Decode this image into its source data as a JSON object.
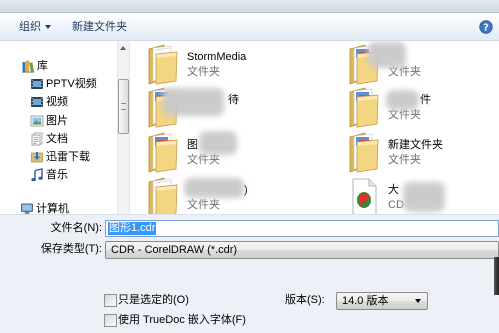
{
  "toolbar": {
    "organize": "组织",
    "organize_icon": "chevron-down-icon",
    "new_folder": "新建文件夹",
    "help_icon": "help-icon"
  },
  "nav": {
    "library": {
      "label": "库",
      "icon": "library-icon"
    },
    "items": [
      {
        "label": "PPTV视频",
        "icon": "video-library-icon"
      },
      {
        "label": "视频",
        "icon": "video-library-icon"
      },
      {
        "label": "图片",
        "icon": "pictures-library-icon"
      },
      {
        "label": "文档",
        "icon": "documents-library-icon"
      },
      {
        "label": "迅雷下载",
        "icon": "download-library-icon"
      },
      {
        "label": "音乐",
        "icon": "music-library-icon"
      }
    ],
    "computer": {
      "label": "计算机",
      "icon": "computer-icon"
    }
  },
  "files": [
    {
      "name": "StormMedia",
      "type": "文件夹",
      "icon": "folder-icon"
    },
    {
      "type": "文件夹",
      "icon": "folder-pictures-icon"
    },
    {
      "name": "待",
      "icon": "folder-pictures-icon"
    },
    {
      "name": "件",
      "type": "文件夹",
      "icon": "folder-pictures-icon"
    },
    {
      "name": "图",
      "type": "文件夹",
      "icon": "folder-pictures-icon"
    },
    {
      "name": "新建文件夹",
      "type": "文件夹",
      "icon": "folder-pictures-icon"
    },
    {
      "name": ")",
      "type": "文件夹",
      "icon": "folder-icon"
    },
    {
      "name": "大",
      "type": "CD",
      "icon": "cdr-file-icon"
    }
  ],
  "form": {
    "filename": {
      "label": "文件名(N):",
      "value": "图形1.cdr"
    },
    "save_type": {
      "label": "保存类型(T):",
      "value": "CDR - CorelDRAW (*.cdr)"
    },
    "only_selected": {
      "label": "只是选定的(O)",
      "checked": false
    },
    "truedoc": {
      "label": "使用 TrueDoc 嵌入字体(F)",
      "checked": false
    },
    "version": {
      "label": "版本(S):",
      "value": "14.0 版本"
    }
  },
  "colors": {
    "selection_highlight": "#3399ff",
    "toolbar_text": "#1e395b",
    "panel_background": "#edf1f7"
  }
}
